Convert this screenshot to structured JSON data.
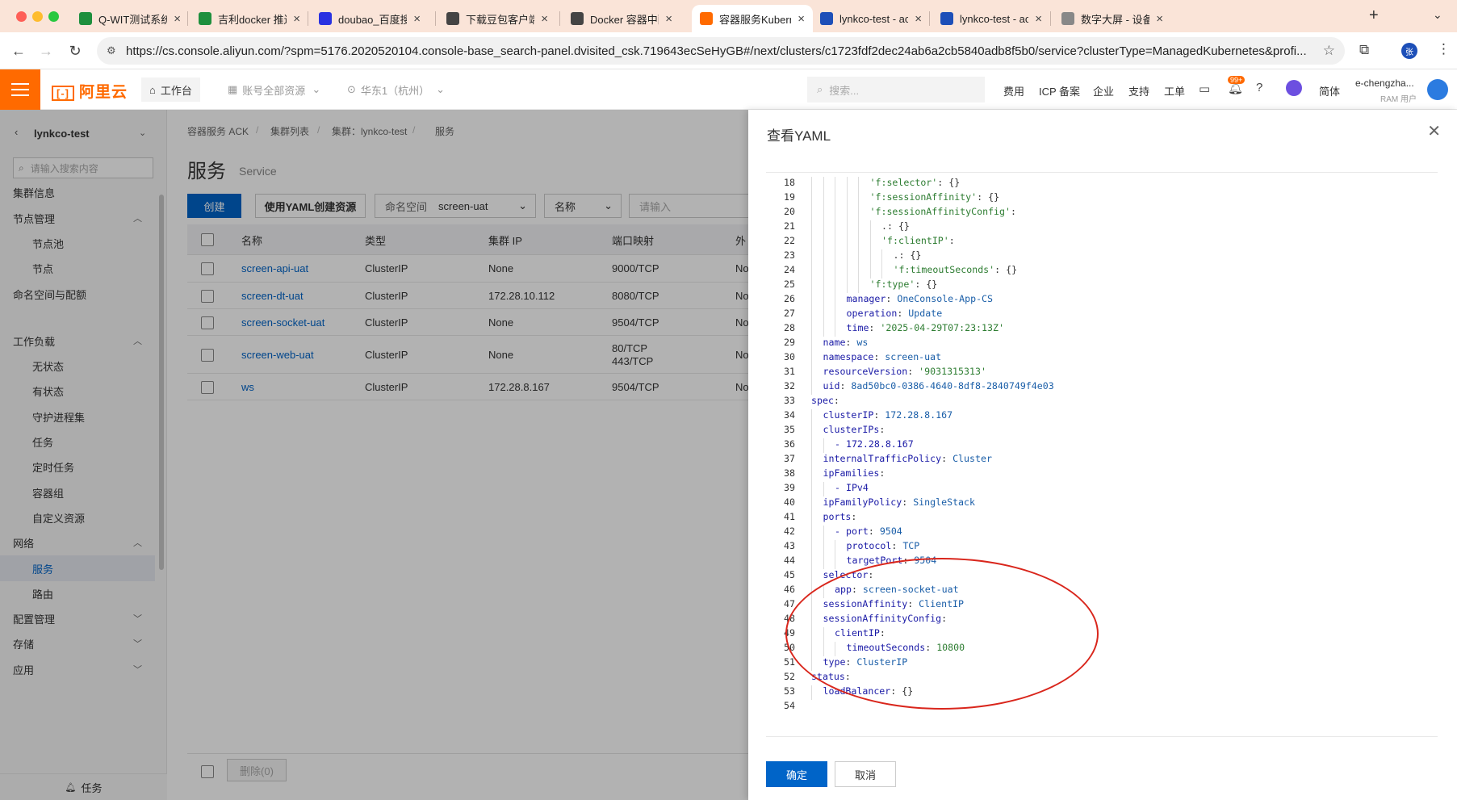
{
  "browser": {
    "tabs": [
      {
        "title": "Q-WIT测试系统-福",
        "icon": "shield-icon",
        "color": "#1e8f3d"
      },
      {
        "title": "吉利docker 推送",
        "icon": "shield-icon",
        "color": "#1e8f3d"
      },
      {
        "title": "doubao_百度搜索",
        "icon": "baidu-paw-icon",
        "color": "#2932e1"
      },
      {
        "title": "下载豆包客户端 - ",
        "icon": "doubao-icon",
        "color": "#444444"
      },
      {
        "title": "Docker 容器中配置",
        "icon": "doubao-icon",
        "color": "#444444"
      },
      {
        "title": "容器服务Kubernete",
        "icon": "aliyun-icon",
        "color": "#ff6a00",
        "active": true
      },
      {
        "title": "lynkco-test - ack_",
        "icon": "ack-icon",
        "color": "#1d4fb8"
      },
      {
        "title": "lynkco-test - ack_",
        "icon": "ack-icon",
        "color": "#1d4fb8"
      },
      {
        "title": "数字大屏 - 设备管理",
        "icon": "globe-icon",
        "color": "#888888"
      }
    ],
    "url": "https://cs.console.aliyun.com/?spm=5176.2020520104.console-base_search-panel.dvisited_csk.719643ecSeHyGB#/next/clusters/c1723fdf2dec24ab6a2cb5840adb8f5b0/service?clusterType=ManagedKubernetes&profi..."
  },
  "header": {
    "logo": "阿里云",
    "workbench": "工作台",
    "account": "账号全部资源",
    "region": "华东1（杭州）",
    "search_placeholder": "搜索...",
    "links": [
      "费用",
      "ICP 备案",
      "企业",
      "支持",
      "工单"
    ],
    "notif_badge": "99+",
    "lang": "简体",
    "user": "e-chengzha...",
    "user_role": "RAM 用户"
  },
  "sidebar": {
    "cluster": "lynkco-test",
    "search_placeholder": "请输入搜索内容",
    "items": [
      {
        "label": "集群信息",
        "level": 1
      },
      {
        "label": "节点管理",
        "level": 1,
        "chevron": "up"
      },
      {
        "label": "节点池",
        "level": 2
      },
      {
        "label": "节点",
        "level": 2
      },
      {
        "label": "命名空间与配额",
        "level": 1
      },
      {
        "label": "工作负载",
        "level": 1,
        "chevron": "up"
      },
      {
        "label": "无状态",
        "level": 2
      },
      {
        "label": "有状态",
        "level": 2
      },
      {
        "label": "守护进程集",
        "level": 2
      },
      {
        "label": "任务",
        "level": 2
      },
      {
        "label": "定时任务",
        "level": 2
      },
      {
        "label": "容器组",
        "level": 2
      },
      {
        "label": "自定义资源",
        "level": 2
      },
      {
        "label": "网络",
        "level": 1,
        "chevron": "up"
      },
      {
        "label": "服务",
        "level": 2,
        "active": true
      },
      {
        "label": "路由",
        "level": 2
      },
      {
        "label": "配置管理",
        "level": 1,
        "chevron": "down"
      },
      {
        "label": "存储",
        "level": 1,
        "chevron": "down"
      },
      {
        "label": "应用",
        "level": 1,
        "chevron": "down"
      }
    ],
    "footer": "任务"
  },
  "main": {
    "breadcrumb": [
      "容器服务 ACK",
      "集群列表",
      "集群：lynkco-test",
      "服务"
    ],
    "title": "服务",
    "subtitle": "Service",
    "create_btn": "创建",
    "yaml_btn": "使用YAML创建资源",
    "namespace_label": "命名空间",
    "namespace_value": "screen-uat",
    "filter_label": "名称",
    "filter_placeholder": "请输入",
    "columns": [
      "名称",
      "类型",
      "集群 IP",
      "端口映射",
      "外"
    ],
    "rows": [
      {
        "name": "screen-api-uat",
        "type": "ClusterIP",
        "ip": "None",
        "ports": [
          "9000/TCP"
        ],
        "ext": "No"
      },
      {
        "name": "screen-dt-uat",
        "type": "ClusterIP",
        "ip": "172.28.10.112",
        "ports": [
          "8080/TCP"
        ],
        "ext": "No"
      },
      {
        "name": "screen-socket-uat",
        "type": "ClusterIP",
        "ip": "None",
        "ports": [
          "9504/TCP"
        ],
        "ext": "No"
      },
      {
        "name": "screen-web-uat",
        "type": "ClusterIP",
        "ip": "None",
        "ports": [
          "80/TCP",
          "443/TCP"
        ],
        "ext": "No"
      },
      {
        "name": "ws",
        "type": "ClusterIP",
        "ip": "172.28.8.167",
        "ports": [
          "9504/TCP"
        ],
        "ext": "No"
      }
    ],
    "delete_btn": "删除(0)"
  },
  "drawer": {
    "title": "查看YAML",
    "ok": "确定",
    "cancel": "取消",
    "lines": [
      {
        "n": 18,
        "indent": 5,
        "key": "'f:selector'",
        "val": "{}",
        "kind": "str"
      },
      {
        "n": 19,
        "indent": 5,
        "key": "'f:sessionAffinity'",
        "val": "{}",
        "kind": "str"
      },
      {
        "n": 20,
        "indent": 5,
        "key": "'f:sessionAffinityConfig'",
        "val": "",
        "kind": "str"
      },
      {
        "n": 21,
        "indent": 6,
        "key": ".",
        "val": "{}",
        "kind": "plain"
      },
      {
        "n": 22,
        "indent": 6,
        "key": "'f:clientIP'",
        "val": "",
        "kind": "str"
      },
      {
        "n": 23,
        "indent": 7,
        "key": ".",
        "val": "{}",
        "kind": "plain"
      },
      {
        "n": 24,
        "indent": 7,
        "key": "'f:timeoutSeconds'",
        "val": "{}",
        "kind": "str"
      },
      {
        "n": 25,
        "indent": 5,
        "key": "'f:type'",
        "val": "{}",
        "kind": "str"
      },
      {
        "n": 26,
        "indent": 3,
        "key": "manager",
        "val": "OneConsole-App-CS",
        "kind": "key"
      },
      {
        "n": 27,
        "indent": 3,
        "key": "operation",
        "val": "Update",
        "kind": "key"
      },
      {
        "n": 28,
        "indent": 3,
        "key": "time",
        "val": "'2025-04-29T07:23:13Z'",
        "kind": "key",
        "valstr": true
      },
      {
        "n": 29,
        "indent": 1,
        "key": "name",
        "val": "ws",
        "kind": "key"
      },
      {
        "n": 30,
        "indent": 1,
        "key": "namespace",
        "val": "screen-uat",
        "kind": "key"
      },
      {
        "n": 31,
        "indent": 1,
        "key": "resourceVersion",
        "val": "'9031315313'",
        "kind": "key",
        "valstr": true
      },
      {
        "n": 32,
        "indent": 1,
        "key": "uid",
        "val": "8ad50bc0-0386-4640-8df8-2840749f4e03",
        "kind": "key"
      },
      {
        "n": 33,
        "indent": 0,
        "key": "spec",
        "val": "",
        "kind": "key"
      },
      {
        "n": 34,
        "indent": 1,
        "key": "clusterIP",
        "val": "172.28.8.167",
        "kind": "key"
      },
      {
        "n": 35,
        "indent": 1,
        "key": "clusterIPs",
        "val": "",
        "kind": "key"
      },
      {
        "n": 36,
        "indent": 2,
        "key": "- 172.28.8.167",
        "val": "",
        "kind": "item"
      },
      {
        "n": 37,
        "indent": 1,
        "key": "internalTrafficPolicy",
        "val": "Cluster",
        "kind": "key"
      },
      {
        "n": 38,
        "indent": 1,
        "key": "ipFamilies",
        "val": "",
        "kind": "key"
      },
      {
        "n": 39,
        "indent": 2,
        "key": "- IPv4",
        "val": "",
        "kind": "item"
      },
      {
        "n": 40,
        "indent": 1,
        "key": "ipFamilyPolicy",
        "val": "SingleStack",
        "kind": "key"
      },
      {
        "n": 41,
        "indent": 1,
        "key": "ports",
        "val": "",
        "kind": "key"
      },
      {
        "n": 42,
        "indent": 2,
        "key": "- port",
        "val": "9504",
        "kind": "key"
      },
      {
        "n": 43,
        "indent": 3,
        "key": "protocol",
        "val": "TCP",
        "kind": "key"
      },
      {
        "n": 44,
        "indent": 3,
        "key": "targetPort",
        "val": "9504",
        "kind": "key"
      },
      {
        "n": 45,
        "indent": 1,
        "key": "selector",
        "val": "",
        "kind": "key"
      },
      {
        "n": 46,
        "indent": 2,
        "key": "app",
        "val": "screen-socket-uat",
        "kind": "key"
      },
      {
        "n": 47,
        "indent": 1,
        "key": "sessionAffinity",
        "val": "ClientIP",
        "kind": "key"
      },
      {
        "n": 48,
        "indent": 1,
        "key": "sessionAffinityConfig",
        "val": "",
        "kind": "key"
      },
      {
        "n": 49,
        "indent": 2,
        "key": "clientIP",
        "val": "",
        "kind": "key"
      },
      {
        "n": 50,
        "indent": 3,
        "key": "timeoutSeconds",
        "val": "10800",
        "kind": "key",
        "valnum": true
      },
      {
        "n": 51,
        "indent": 1,
        "key": "type",
        "val": "ClusterIP",
        "kind": "key"
      },
      {
        "n": 52,
        "indent": 0,
        "key": "status",
        "val": "",
        "kind": "key"
      },
      {
        "n": 53,
        "indent": 1,
        "key": "loadBalancer",
        "val": "{}",
        "kind": "key"
      },
      {
        "n": 54,
        "indent": 0,
        "key": "",
        "val": "",
        "kind": "blank"
      }
    ]
  },
  "colors": {
    "accent": "#0064c8",
    "brand": "#ff6a00",
    "annotation": "#d9261c"
  }
}
